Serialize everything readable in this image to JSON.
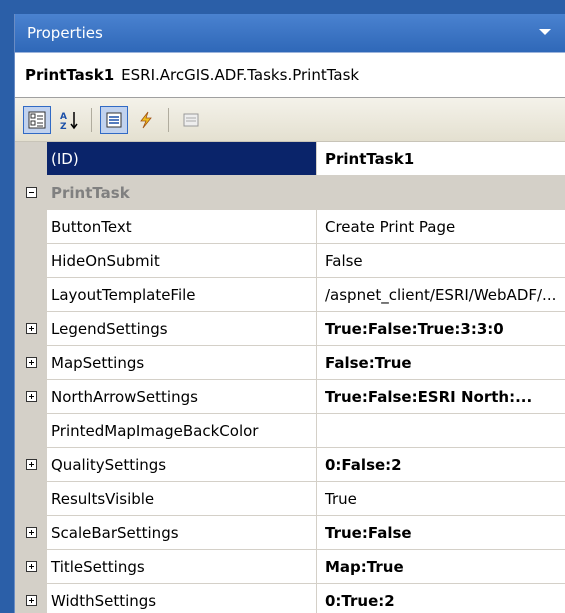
{
  "panel": {
    "title": "Properties"
  },
  "object": {
    "name": "PrintTask1",
    "type": "ESRI.ArcGIS.ADF.Tasks.PrintTask"
  },
  "toolbar": {
    "buttons": [
      {
        "icon": "categorized-icon",
        "active": true
      },
      {
        "icon": "alphabetical-icon",
        "active": false
      },
      {
        "icon": "properties-icon",
        "active": true
      },
      {
        "icon": "events-icon",
        "active": false
      },
      {
        "icon": "property-pages-icon",
        "active": false
      }
    ]
  },
  "grid": {
    "id_row": {
      "name": "(ID)",
      "value": "PrintTask1"
    },
    "category": {
      "label": "PrintTask",
      "expanded": true
    },
    "rows": [
      {
        "name": "ButtonText",
        "value": "Create Print Page",
        "bold": false,
        "expandable": false
      },
      {
        "name": "HideOnSubmit",
        "value": "False",
        "bold": false,
        "expandable": false
      },
      {
        "name": "LayoutTemplateFile",
        "value": "/aspnet_client/ESRI/WebADF/...",
        "bold": false,
        "expandable": false
      },
      {
        "name": "LegendSettings",
        "value": "True:False:True:3:3:0",
        "bold": true,
        "expandable": true
      },
      {
        "name": "MapSettings",
        "value": "False:True",
        "bold": true,
        "expandable": true
      },
      {
        "name": "NorthArrowSettings",
        "value": "True:False:ESRI North:...",
        "bold": true,
        "expandable": true
      },
      {
        "name": "PrintedMapImageBackColor",
        "value": "",
        "bold": false,
        "expandable": false
      },
      {
        "name": "QualitySettings",
        "value": "0:False:2",
        "bold": true,
        "expandable": true
      },
      {
        "name": "ResultsVisible",
        "value": "True",
        "bold": false,
        "expandable": false
      },
      {
        "name": "ScaleBarSettings",
        "value": "True:False",
        "bold": true,
        "expandable": true
      },
      {
        "name": "TitleSettings",
        "value": "Map:True",
        "bold": true,
        "expandable": true
      },
      {
        "name": "WidthSettings",
        "value": "0:True:2",
        "bold": true,
        "expandable": true
      }
    ]
  }
}
